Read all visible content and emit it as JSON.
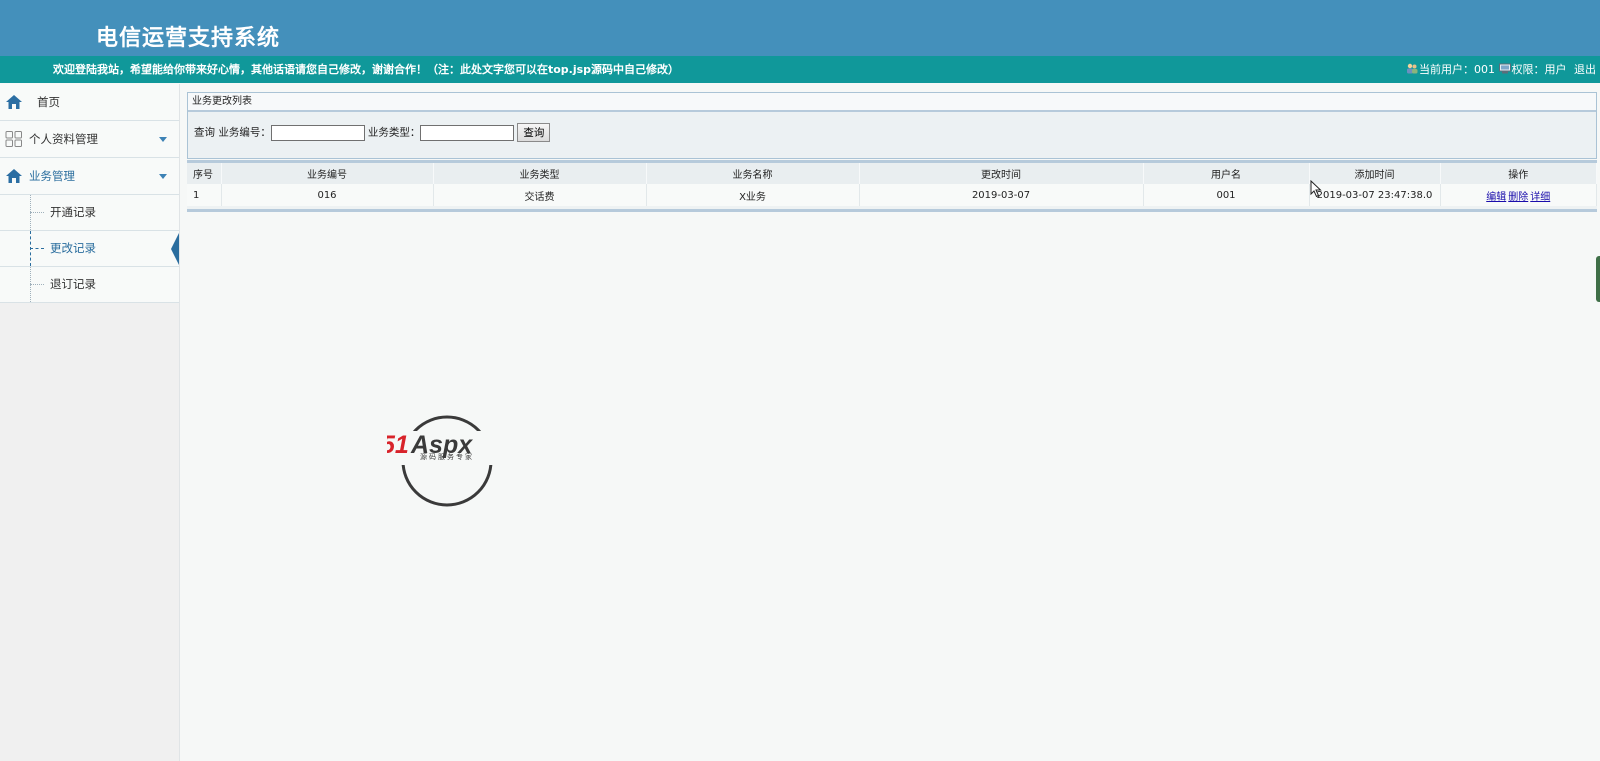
{
  "header": {
    "title": "电信运营支持系统",
    "welcome": "欢迎登陆我站，希望能给你带来好心情，其他话语请您自己修改，谢谢合作！（注：此处文字您可以在top.jsp源码中自己修改）",
    "current_user": "当前用户：001",
    "permission": "权限：用户",
    "logout": "退出"
  },
  "sidebar": {
    "home": "首页",
    "profile": "个人资料管理",
    "business": "业务管理",
    "sub_items": [
      "开通记录",
      "更改记录",
      "退订记录"
    ],
    "active_index": 1
  },
  "panel": {
    "title": "业务更改列表",
    "query_label": "查询",
    "field1_label": "业务编号：",
    "field1_value": "",
    "field2_label": "业务类型：",
    "field2_value": "",
    "button": "查询"
  },
  "table": {
    "headers": [
      "序号",
      "业务编号",
      "业务类型",
      "业务名称",
      "更改时间",
      "用户名",
      "添加时间",
      "操作"
    ],
    "rows": [
      {
        "index": "1",
        "code": "016",
        "type": "交话费",
        "name": "X业务",
        "change_time": "2019-03-07",
        "user": "001",
        "add_time": "2019-03-07 23:47:38.0"
      }
    ],
    "actions": [
      "编辑",
      "删除",
      "详细"
    ]
  },
  "watermark": {
    "brand": "51Aspx",
    "tagline": "源码服务专家"
  },
  "colors": {
    "topbar": "#4490bb",
    "subbar": "#10989a",
    "accent": "#2a6d9e"
  }
}
